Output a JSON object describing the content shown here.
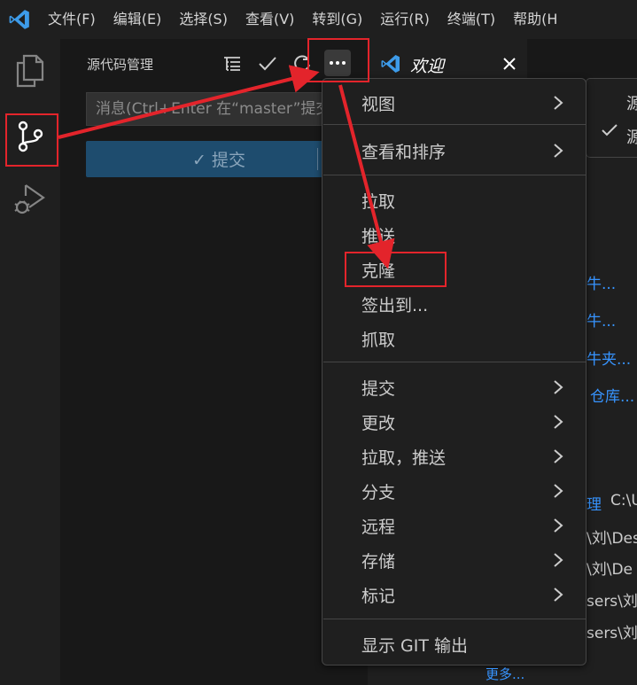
{
  "menubar": {
    "items": [
      "文件(F)",
      "编辑(E)",
      "选择(S)",
      "查看(V)",
      "转到(G)",
      "运行(R)",
      "终端(T)",
      "帮助(H"
    ]
  },
  "activitybar": {
    "icons": [
      "explorer-icon",
      "source-control-icon",
      "run-debug-icon"
    ]
  },
  "sidebar": {
    "title": "源代码管理",
    "actions": [
      "list-tree-icon",
      "check-icon",
      "refresh-icon",
      "more-actions-icon"
    ],
    "commit_input_placeholder": "消息(Ctrl+Enter 在“master”提交)",
    "commit_button_label": "✓ 提交"
  },
  "editor": {
    "tab_title": "欢迎",
    "background_fragments": {
      "f1": "牛...",
      "f2": "牛...",
      "f3": "牛夹...",
      "f4": "仓库...",
      "f5": "C:\\U",
      "f6": "\\刘\\Des",
      "f7": "\\刘\\De",
      "f8": "sers\\刘\\",
      "f9": "sers\\刘",
      "f10": "更多..."
    }
  },
  "submenu": {
    "line1": "源",
    "line2": "源"
  },
  "context_menu": {
    "items": [
      {
        "label": "视图",
        "submenu": true
      },
      {
        "label": "查看和排序",
        "submenu": true
      },
      {
        "label": "拉取",
        "submenu": false
      },
      {
        "label": "推送",
        "submenu": false
      },
      {
        "label": "克隆",
        "submenu": false
      },
      {
        "label": "签出到...",
        "submenu": false
      },
      {
        "label": "抓取",
        "submenu": false
      },
      {
        "label": "提交",
        "submenu": true
      },
      {
        "label": "更改",
        "submenu": true
      },
      {
        "label": "拉取，推送",
        "submenu": true
      },
      {
        "label": "分支",
        "submenu": true
      },
      {
        "label": "远程",
        "submenu": true
      },
      {
        "label": "存储",
        "submenu": true
      },
      {
        "label": "标记",
        "submenu": true
      },
      {
        "label": "显示 GIT 输出",
        "submenu": false
      }
    ]
  },
  "colors": {
    "annotation_red": "#e3242b",
    "vscode_blue": "#3794ff",
    "commit_button_bg": "#1e4c6e"
  }
}
